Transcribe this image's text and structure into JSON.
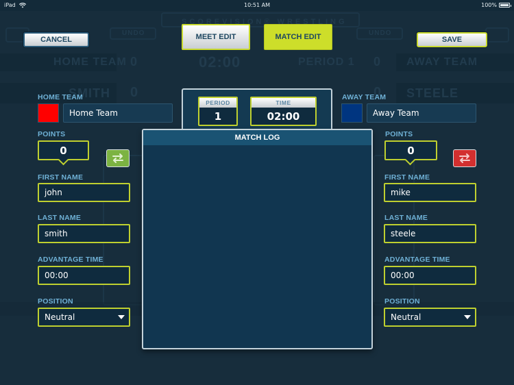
{
  "status_bar": {
    "device": "iPad",
    "time": "10:51 AM",
    "battery": "100%",
    "battery_level": 1.0
  },
  "background": {
    "app_title": "SCOREVISION® WRESTLING",
    "undo_label": "UNDO",
    "home_team": "HOME TEAM",
    "home_score": "0",
    "clock": "02:00",
    "period": "PERIOD 1",
    "away_score": "0",
    "away_team": "AWAY TEAM",
    "home_wrestler": "SMITH",
    "home_wrestler_score": "0",
    "away_wrestler": "STEELE",
    "away_wrestler_score": "0"
  },
  "toolbar": {
    "cancel_label": "CANCEL",
    "meet_edit_label": "MEET EDIT",
    "match_edit_label": "MATCH EDIT",
    "save_label": "SAVE",
    "active_tab": "MATCH EDIT"
  },
  "home": {
    "team_label": "HOME TEAM",
    "team_color": "#ff0000",
    "team_name": "Home Team",
    "points_label": "POINTS",
    "points": "0",
    "first_name_label": "FIRST NAME",
    "first_name": "john",
    "last_name_label": "LAST NAME",
    "last_name": "smith",
    "advantage_label": "ADVANTAGE TIME",
    "advantage_time": "00:00",
    "position_label": "POSITION",
    "position": "Neutral",
    "swap_color": "#7cb342"
  },
  "away": {
    "team_label": "AWAY TEAM",
    "team_color": "#003580",
    "team_name": "Away Team",
    "points_label": "POINTS",
    "points": "0",
    "first_name_label": "FIRST NAME",
    "first_name": "mike",
    "last_name_label": "LAST NAME",
    "last_name": "steele",
    "advantage_label": "ADVANTAGE TIME",
    "advantage_time": "00:00",
    "position_label": "POSITION",
    "position": "Neutral",
    "swap_color": "#d32f2f"
  },
  "clock": {
    "period_label": "PERIOD",
    "period": "1",
    "time_label": "TIME",
    "time": "02:00"
  },
  "match_log": {
    "title": "MATCH LOG",
    "entries": []
  },
  "colors": {
    "accent": "#cdde2a",
    "label": "#6fb1d6",
    "background": "#172d3c"
  }
}
